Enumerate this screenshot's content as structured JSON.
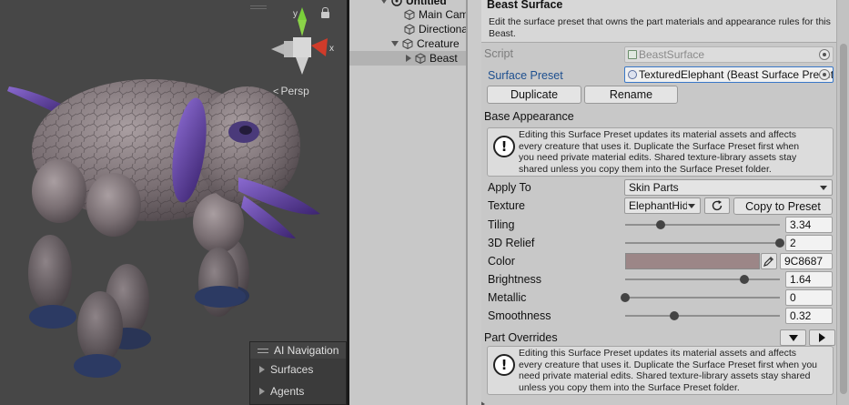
{
  "scene": {
    "view_mode_label": "Persp",
    "gizmo": {
      "y_label": "y",
      "x_label": "x"
    },
    "nav_overlay": {
      "title": "AI Navigation",
      "items": [
        {
          "label": "Surfaces"
        },
        {
          "label": "Agents"
        }
      ]
    }
  },
  "hierarchy": {
    "rows": [
      {
        "label": "Untitled",
        "expanded": true
      },
      {
        "label": "Main Camera"
      },
      {
        "label": "Directional Light"
      },
      {
        "label": "Creature",
        "expanded": true
      },
      {
        "label": "Beast",
        "selected": true
      }
    ]
  },
  "inspector": {
    "title": "Beast Surface",
    "description": "Edit the surface preset that owns the part materials and appearance rules for this Beast.",
    "script": {
      "label": "Script",
      "value": "BeastSurface"
    },
    "surface_preset": {
      "label": "Surface Preset",
      "value": "TexturedElephant (Beast Surface Preset)"
    },
    "duplicate_label": "Duplicate",
    "rename_label": "Rename",
    "base_appearance": {
      "title": "Base Appearance",
      "help": "Editing this Surface Preset updates its material assets and affects every creature that uses it. Duplicate the Surface Preset first when you need private material edits. Shared texture-library assets stay shared unless you copy them into the Surface Preset folder.",
      "help_lines": [
        "Editing this Surface Preset updates its material assets and affects",
        "every creature that uses it. Duplicate the Surface Preset first when",
        "you need private material edits. Shared texture-library assets stay",
        "shared unless you copy them into the Surface Preset folder."
      ],
      "apply_to": {
        "label": "Apply To",
        "value": "Skin Parts"
      },
      "texture": {
        "label": "Texture",
        "value": "ElephantHide",
        "copy_label": "Copy to Preset"
      },
      "tiling": {
        "label": "Tiling",
        "value": "3.34",
        "fraction": 0.23
      },
      "relief": {
        "label": "3D Relief",
        "value": "2",
        "fraction": 1.0
      },
      "color": {
        "label": "Color",
        "hex": "9C8687",
        "swatch": "#9C8687"
      },
      "brightness": {
        "label": "Brightness",
        "value": "1.64",
        "fraction": 0.77
      },
      "metallic": {
        "label": "Metallic",
        "value": "0",
        "fraction": 0.0
      },
      "smoothness": {
        "label": "Smoothness",
        "value": "0.32",
        "fraction": 0.32
      }
    },
    "part_overrides": {
      "title": "Part Overrides",
      "help_lines": [
        "Editing this Surface Preset updates its material assets and affects",
        "every creature that uses it. Duplicate the Surface Preset first when you",
        "need private material edits. Shared texture-library assets stay shared",
        "unless you copy them into the Surface Preset folder."
      ]
    }
  },
  "colors": {
    "scene_bg": "#474747",
    "panel_bg": "#C8C8C8",
    "accent_blue": "#3A78C8",
    "creature_body": "#7E7276",
    "creature_purple": "#5C3C9A"
  },
  "icons": [
    "gizmo-icon",
    "lock-icon",
    "cube-icon",
    "info-icon",
    "refresh-icon",
    "eyedropper-icon",
    "object-picker-icon"
  ]
}
